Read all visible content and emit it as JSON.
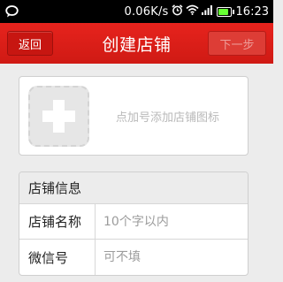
{
  "colors": {
    "accent": "#d81e18",
    "status_bar": "#000000",
    "battery": "#66ff33",
    "background": "#ececec",
    "placeholder_text": "#b9b9b9"
  },
  "status_bar": {
    "icons": [
      "chat-notification-icon",
      "alarm-icon",
      "wifi-icon",
      "signal-icon",
      "battery-icon"
    ],
    "speed": "0.06K/s",
    "time": "16:23",
    "battery_level": 0.85
  },
  "title_bar": {
    "back_label": "返回",
    "title": "创建店铺",
    "next_label": "下一步"
  },
  "logo_upload": {
    "icon": "plus-icon",
    "hint": "点加号添加店铺图标"
  },
  "shop_info": {
    "header": "店铺信息",
    "fields": [
      {
        "label": "店铺名称",
        "value": "",
        "placeholder": "10个字以内"
      },
      {
        "label": "微信号",
        "value": "",
        "placeholder": "可不填"
      }
    ]
  }
}
